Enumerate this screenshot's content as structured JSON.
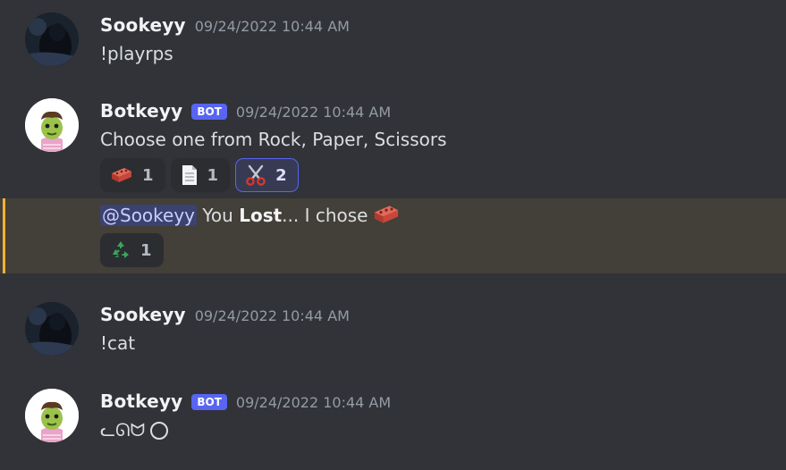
{
  "messages": [
    {
      "username": "Sookeyy",
      "timestamp": "09/24/2022 10:44 AM",
      "text": "!playrps"
    },
    {
      "username": "Botkeyy",
      "bot_tag": "BOT",
      "timestamp": "09/24/2022 10:44 AM",
      "text": "Choose one from Rock, Paper, Scissors",
      "reactions": [
        {
          "emoji": "brick-emoji",
          "count": "1"
        },
        {
          "emoji": "page-emoji",
          "count": "1"
        },
        {
          "emoji": "scissors-emoji",
          "count": "2",
          "active": true
        }
      ],
      "followup": {
        "mention": "@Sookeyy",
        "text_before": " You ",
        "bold": "Lost",
        "text_after": "... I chose",
        "emoji": "brick-emoji",
        "reactions": [
          {
            "emoji": "recycle-emoji",
            "count": "1"
          }
        ]
      }
    },
    {
      "username": "Sookeyy",
      "timestamp": "09/24/2022 10:44 AM",
      "text": "!cat"
    },
    {
      "username": "Botkeyy",
      "bot_tag": "BOT",
      "timestamp": "09/24/2022 10:44 AM",
      "text": "ᓚᘏᗢ"
    }
  ],
  "colors": {
    "background": "#313338",
    "bot_tag": "#5865f2",
    "highlight": "#433f39",
    "highlight_bar": "#f0b232",
    "mention_bg": "#3c4270"
  }
}
